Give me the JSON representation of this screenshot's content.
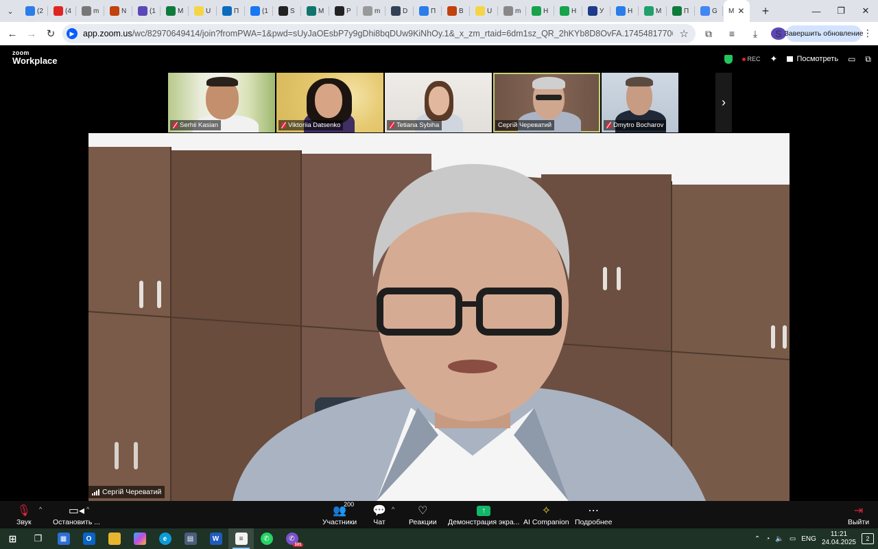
{
  "browser": {
    "tabs": [
      {
        "title": "(2",
        "color": "#2b7de9"
      },
      {
        "title": "(4",
        "color": "#e02424"
      },
      {
        "title": "m",
        "color": "#777777"
      },
      {
        "title": "N",
        "color": "#c2410c"
      },
      {
        "title": "(1",
        "color": "#5c47b8"
      },
      {
        "title": "M",
        "color": "#0f7b3b"
      },
      {
        "title": "U",
        "color": "#f5d547"
      },
      {
        "title": "П",
        "color": "#0b6cbd"
      },
      {
        "title": "(1",
        "color": "#1877f2"
      },
      {
        "title": "S",
        "color": "#222222"
      },
      {
        "title": "M",
        "color": "#0f766e"
      },
      {
        "title": "P",
        "color": "#222222"
      },
      {
        "title": "m",
        "color": "#999999"
      },
      {
        "title": "D",
        "color": "#334155"
      },
      {
        "title": "П",
        "color": "#2b7de9"
      },
      {
        "title": "B",
        "color": "#c2410c"
      },
      {
        "title": "U",
        "color": "#f5d547"
      },
      {
        "title": "m",
        "color": "#888888"
      },
      {
        "title": "H",
        "color": "#16a34a"
      },
      {
        "title": "H",
        "color": "#16a34a"
      },
      {
        "title": "У",
        "color": "#1e3a8a"
      },
      {
        "title": "H",
        "color": "#2b7de9"
      },
      {
        "title": "M",
        "color": "#22a06b"
      },
      {
        "title": "П",
        "color": "#0f7b3b"
      },
      {
        "title": "G",
        "color": "#4285f4"
      }
    ],
    "active_tab_title": "M",
    "url_host": "app.zoom.us",
    "url_path": "/wc/82970649414/join?fromPWA=1&pwd=sUyJaOEsbP7y9gDhi8bqDUw9KiNhOy.1&_x_zm_rtaid=6dm1sz_QR_2hKYb8D8OvFA.1745481770655.a8f6fb8e2bfa88feb7f767...",
    "update_button": "Завершить обновление",
    "profile_letter": "S"
  },
  "zoom": {
    "logo_top": "zoom",
    "logo_bottom": "Workplace",
    "rec_label": "REC",
    "view_label": "Посмотреть",
    "participants": [
      {
        "name": "Serhii Kasian",
        "muted": true
      },
      {
        "name": "Viktoriia Datsenko",
        "muted": true
      },
      {
        "name": "Tetiana Sybiha",
        "muted": true
      },
      {
        "name": "Сергій Череватий",
        "muted": false
      },
      {
        "name": "Dmytro Bocharov",
        "muted": true
      }
    ],
    "active_speaker": "Сергій Череватий",
    "controls": {
      "audio": "Звук",
      "video": "Остановить ...",
      "participants": "Участники",
      "participants_count": "200",
      "chat": "Чат",
      "reactions": "Реакции",
      "share": "Демонстрация экра...",
      "ai": "AI Companion",
      "more": "Подробнее",
      "leave": "Выйти"
    }
  },
  "taskbar": {
    "language": "ENG",
    "time": "11:21",
    "date": "24.04.2025",
    "notifications": "2",
    "viber_badge": "101"
  }
}
